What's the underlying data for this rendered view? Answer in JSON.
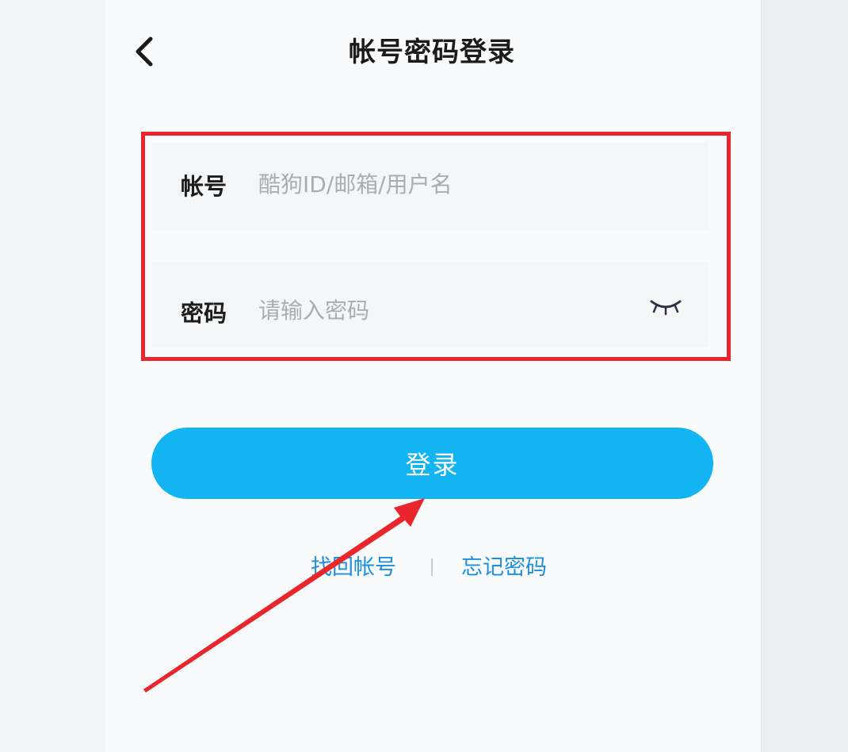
{
  "header": {
    "back_icon": "chevron-left-icon",
    "title": "帐号密码登录"
  },
  "form": {
    "account": {
      "label": "帐号",
      "value": "",
      "placeholder": "酷狗ID/邮箱/用户名"
    },
    "password": {
      "label": "密码",
      "value": "",
      "placeholder": "请输入密码",
      "toggle_icon": "eye-closed-icon"
    },
    "highlight_color": "#e9262b"
  },
  "actions": {
    "login_label": "登录",
    "login_color": "#12b4f2"
  },
  "links": {
    "find_account": "找回帐号",
    "forgot_password": "忘记密码",
    "color": "#1d8fe0"
  },
  "annotation": {
    "arrow_color": "#e9262b"
  }
}
